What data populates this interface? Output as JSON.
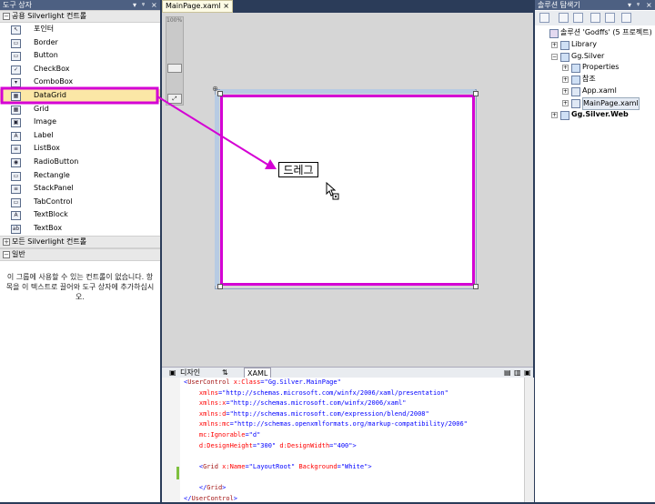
{
  "toolbox": {
    "title": "도구 상자",
    "header_buttons": [
      "▾",
      "ᵠ",
      "×"
    ],
    "group_common": "공용 Silverlight 컨트롤",
    "items": [
      {
        "label": "포인터",
        "icon": "pointer-icon",
        "glyph": "↖"
      },
      {
        "label": "Border",
        "icon": "border-icon",
        "glyph": "▭"
      },
      {
        "label": "Button",
        "icon": "button-icon",
        "glyph": "▭"
      },
      {
        "label": "CheckBox",
        "icon": "checkbox-icon",
        "glyph": "✓"
      },
      {
        "label": "ComboBox",
        "icon": "combobox-icon",
        "glyph": "▾"
      },
      {
        "label": "DataGrid",
        "icon": "datagrid-icon",
        "glyph": "▦"
      },
      {
        "label": "Grid",
        "icon": "grid-icon",
        "glyph": "▦"
      },
      {
        "label": "Image",
        "icon": "image-icon",
        "glyph": "▣"
      },
      {
        "label": "Label",
        "icon": "label-icon",
        "glyph": "A"
      },
      {
        "label": "ListBox",
        "icon": "listbox-icon",
        "glyph": "≡"
      },
      {
        "label": "RadioButton",
        "icon": "radiobutton-icon",
        "glyph": "◉"
      },
      {
        "label": "Rectangle",
        "icon": "rectangle-icon",
        "glyph": "▭"
      },
      {
        "label": "StackPanel",
        "icon": "stackpanel-icon",
        "glyph": "≡"
      },
      {
        "label": "TabControl",
        "icon": "tabcontrol-icon",
        "glyph": "▭"
      },
      {
        "label": "TextBlock",
        "icon": "textblock-icon",
        "glyph": "A"
      },
      {
        "label": "TextBox",
        "icon": "textbox-icon",
        "glyph": "ab"
      }
    ],
    "group_all": "모든 Silverlight 컨트롤",
    "group_general": "일반",
    "hint": "이 그룹에 사용할 수 있는 컨트롤이 없습니다. 항목을 이 텍스트로 끌어와 도구 상자에 추가하십시오."
  },
  "editor": {
    "tab_label": "MainPage.xaml",
    "tab_close": "×",
    "zoom_label": "100%",
    "drag_label": "드레그",
    "design_tab": "디자인",
    "swap_tab": "⇅",
    "xaml_tab": "XAML",
    "code_lines": [
      [
        {
          "t": "<",
          "c": "k"
        },
        {
          "t": "UserControl",
          "c": ""
        },
        {
          "t": " x:Class",
          "c": "r"
        },
        {
          "t": "=",
          "c": "k"
        },
        {
          "t": "\"Gg.Silver.MainPage\"",
          "c": "s"
        }
      ],
      [
        {
          "t": "    xmlns",
          "c": "r"
        },
        {
          "t": "=",
          "c": "k"
        },
        {
          "t": "\"http://schemas.microsoft.com/winfx/2006/xaml/presentation\"",
          "c": "s"
        }
      ],
      [
        {
          "t": "    xmlns:x",
          "c": "r"
        },
        {
          "t": "=",
          "c": "k"
        },
        {
          "t": "\"http://schemas.microsoft.com/winfx/2006/xaml\"",
          "c": "s"
        }
      ],
      [
        {
          "t": "    xmlns:d",
          "c": "r"
        },
        {
          "t": "=",
          "c": "k"
        },
        {
          "t": "\"http://schemas.microsoft.com/expression/blend/2008\"",
          "c": "s"
        }
      ],
      [
        {
          "t": "    xmlns:mc",
          "c": "r"
        },
        {
          "t": "=",
          "c": "k"
        },
        {
          "t": "\"http://schemas.openxmlformats.org/markup-compatibility/2006\"",
          "c": "s"
        }
      ],
      [
        {
          "t": "    mc:Ignorable",
          "c": "r"
        },
        {
          "t": "=",
          "c": "k"
        },
        {
          "t": "\"d\"",
          "c": "s"
        }
      ],
      [
        {
          "t": "    d:DesignHeight",
          "c": "r"
        },
        {
          "t": "=",
          "c": "k"
        },
        {
          "t": "\"300\"",
          "c": "s"
        },
        {
          "t": " d:DesignWidth",
          "c": "r"
        },
        {
          "t": "=",
          "c": "k"
        },
        {
          "t": "\"400\"",
          "c": "s"
        },
        {
          "t": ">",
          "c": "k"
        }
      ],
      [],
      [
        {
          "t": "    <",
          "c": "k"
        },
        {
          "t": "Grid",
          "c": ""
        },
        {
          "t": " x:Name",
          "c": "r"
        },
        {
          "t": "=",
          "c": "k"
        },
        {
          "t": "\"LayoutRoot\"",
          "c": "s"
        },
        {
          "t": " Background",
          "c": "r"
        },
        {
          "t": "=",
          "c": "k"
        },
        {
          "t": "\"White\"",
          "c": "s"
        },
        {
          "t": ">",
          "c": "k"
        }
      ],
      [],
      [
        {
          "t": "    </",
          "c": "k"
        },
        {
          "t": "Grid",
          "c": ""
        },
        {
          "t": ">",
          "c": "k"
        }
      ],
      [
        {
          "t": "</",
          "c": "k"
        },
        {
          "t": "UserControl",
          "c": ""
        },
        {
          "t": ">",
          "c": "k"
        }
      ]
    ]
  },
  "solution": {
    "title": "솔루션 탐색기",
    "header_buttons": [
      "▾",
      "ᵠ",
      "×"
    ],
    "tree": [
      {
        "label": "솔루션 'Godffs' (5 프로젝트)",
        "indent": 0,
        "exp": "",
        "icon": "solution-icon",
        "bold": false
      },
      {
        "label": "Library",
        "indent": 1,
        "exp": "+",
        "icon": "project-icon",
        "bold": false
      },
      {
        "label": "Gg.Silver",
        "indent": 1,
        "exp": "−",
        "icon": "project-icon",
        "bold": false
      },
      {
        "label": "Properties",
        "indent": 2,
        "exp": "+",
        "icon": "properties-icon",
        "bold": false
      },
      {
        "label": "참조",
        "indent": 2,
        "exp": "+",
        "icon": "references-icon",
        "bold": false
      },
      {
        "label": "App.xaml",
        "indent": 2,
        "exp": "+",
        "icon": "xaml-file-icon",
        "bold": false
      },
      {
        "label": "MainPage.xaml",
        "indent": 2,
        "exp": "+",
        "icon": "xaml-file-icon",
        "bold": false,
        "selected": true
      },
      {
        "label": "Gg.Silver.Web",
        "indent": 1,
        "exp": "+",
        "icon": "web-project-icon",
        "bold": true
      }
    ]
  },
  "colors": {
    "highlight": "#d400d4",
    "chrome": "#2b3c59",
    "header": "#4d6082"
  }
}
